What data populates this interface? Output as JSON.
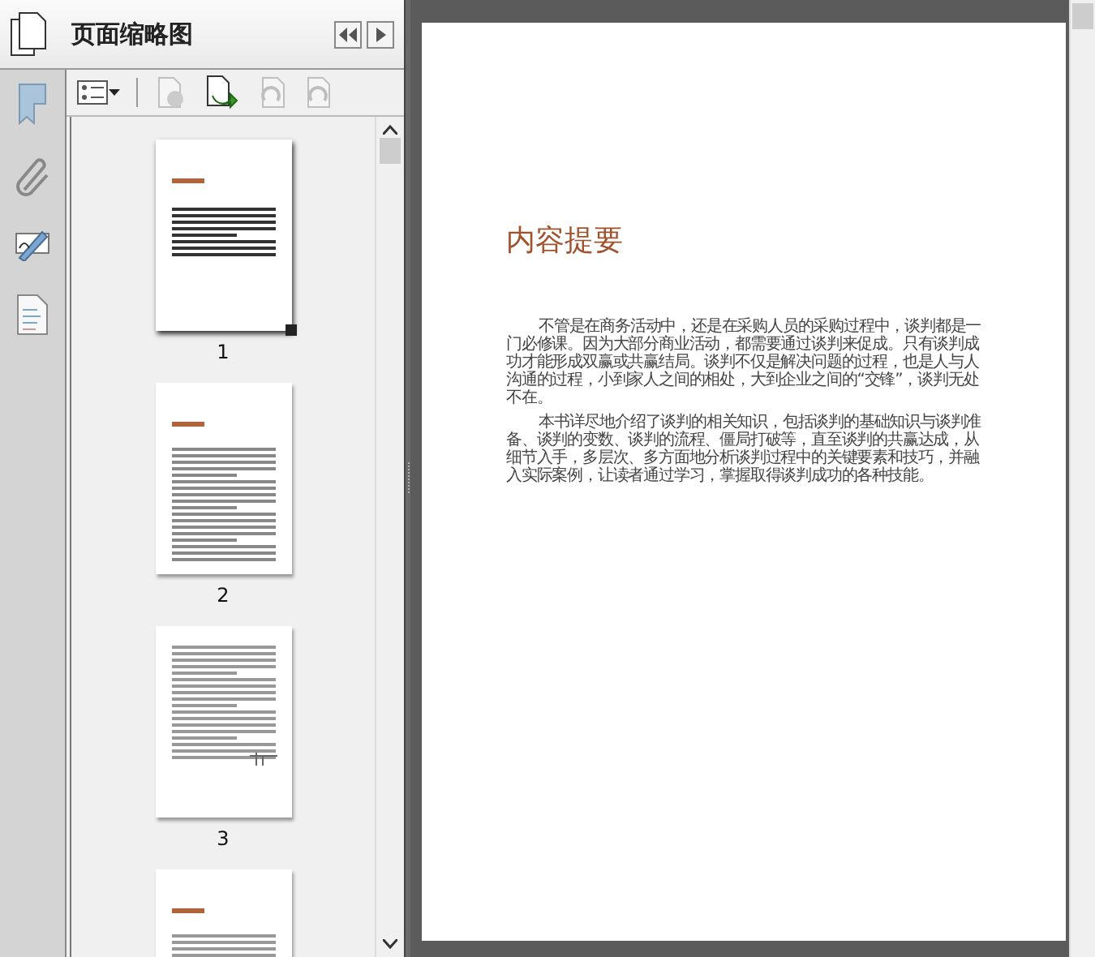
{
  "panel": {
    "title": "页面缩略图"
  },
  "toolbar": [
    {
      "kind": "options",
      "disabled": false
    },
    {
      "kind": "delete",
      "disabled": true
    },
    {
      "kind": "insert",
      "disabled": false
    },
    {
      "kind": "rotate-left",
      "disabled": true
    },
    {
      "kind": "rotate-right",
      "disabled": true
    }
  ],
  "thumbnails": [
    {
      "label": "1",
      "selected": true,
      "kind": "summary"
    },
    {
      "label": "2",
      "selected": false,
      "kind": "chapter"
    },
    {
      "label": "3",
      "selected": false,
      "kind": "preface"
    },
    {
      "selected": false,
      "kind": "contents"
    }
  ],
  "document": {
    "title": "内容提要",
    "paragraphs": [
      "不管是在商务活动中，还是在采购人员的采购过程中，谈判都是一门必修课。因为大部分商业活动，都需要通过谈判来促成。只有谈判成功才能形成双赢或共赢结局。谈判不仅是解决问题的过程，也是人与人沟通的过程，小到家人之间的相处，大到企业之间的“交锋”，谈判无处不在。",
      "本书详尽地介绍了谈判的相关知识，包括谈判的基础知识与谈判准备、谈判的变数、谈判的流程、僵局打破等，直至谈判的共赢达成，从细节入手，多层次、多方面地分析谈判过程中的关键要素和技巧，并融入实际案例，让读者通过学习，掌握取得谈判成功的各种技能。"
    ]
  }
}
